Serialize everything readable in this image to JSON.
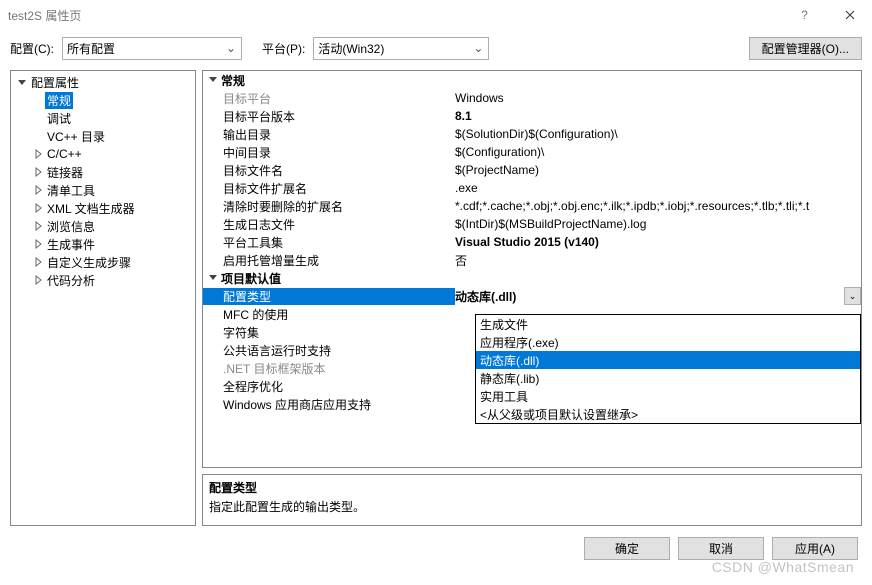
{
  "window": {
    "title": "test2S 属性页"
  },
  "toolbar": {
    "config_label": "配置(C):",
    "config_value": "所有配置",
    "platform_label": "平台(P):",
    "platform_value": "活动(Win32)",
    "manager": "配置管理器(O)..."
  },
  "tree": {
    "root": "配置属性",
    "items": [
      {
        "label": "常规",
        "selected": true,
        "expandable": false
      },
      {
        "label": "调试",
        "expandable": false
      },
      {
        "label": "VC++ 目录",
        "expandable": false
      },
      {
        "label": "C/C++",
        "expandable": true
      },
      {
        "label": "链接器",
        "expandable": true
      },
      {
        "label": "清单工具",
        "expandable": true
      },
      {
        "label": "XML 文档生成器",
        "expandable": true
      },
      {
        "label": "浏览信息",
        "expandable": true
      },
      {
        "label": "生成事件",
        "expandable": true
      },
      {
        "label": "自定义生成步骤",
        "expandable": true
      },
      {
        "label": "代码分析",
        "expandable": true
      }
    ]
  },
  "groups": [
    {
      "name": "常规",
      "rows": [
        {
          "name": "目标平台",
          "value": "Windows",
          "dim": true
        },
        {
          "name": "目标平台版本",
          "value": "8.1",
          "bold": true
        },
        {
          "name": "输出目录",
          "value": "$(SolutionDir)$(Configuration)\\"
        },
        {
          "name": "中间目录",
          "value": "$(Configuration)\\"
        },
        {
          "name": "目标文件名",
          "value": "$(ProjectName)"
        },
        {
          "name": "目标文件扩展名",
          "value": ".exe"
        },
        {
          "name": "清除时要删除的扩展名",
          "value": "*.cdf;*.cache;*.obj;*.obj.enc;*.ilk;*.ipdb;*.iobj;*.resources;*.tlb;*.tli;*.t"
        },
        {
          "name": "生成日志文件",
          "value": "$(IntDir)$(MSBuildProjectName).log"
        },
        {
          "name": "平台工具集",
          "value": "Visual Studio 2015 (v140)",
          "bold": true
        },
        {
          "name": "启用托管增量生成",
          "value": "否"
        }
      ]
    },
    {
      "name": "项目默认值",
      "rows": [
        {
          "name": "配置类型",
          "value": "动态库(.dll)",
          "selected": true
        },
        {
          "name": "MFC 的使用",
          "value": ""
        },
        {
          "name": "字符集",
          "value": ""
        },
        {
          "name": "公共语言运行时支持",
          "value": ""
        },
        {
          "name": ".NET 目标框架版本",
          "value": "",
          "dim": true
        },
        {
          "name": "全程序优化",
          "value": ""
        },
        {
          "name": "Windows 应用商店应用支持",
          "value": ""
        }
      ]
    }
  ],
  "dropdown": {
    "options": [
      "生成文件",
      "应用程序(.exe)",
      "动态库(.dll)",
      "静态库(.lib)",
      "实用工具",
      "<从父级或项目默认设置继承>"
    ],
    "selected": "动态库(.dll)"
  },
  "description": {
    "title": "配置类型",
    "text": "指定此配置生成的输出类型。"
  },
  "footer": {
    "ok": "确定",
    "cancel": "取消",
    "apply": "应用(A)"
  },
  "watermark": "CSDN @WhatSmean"
}
